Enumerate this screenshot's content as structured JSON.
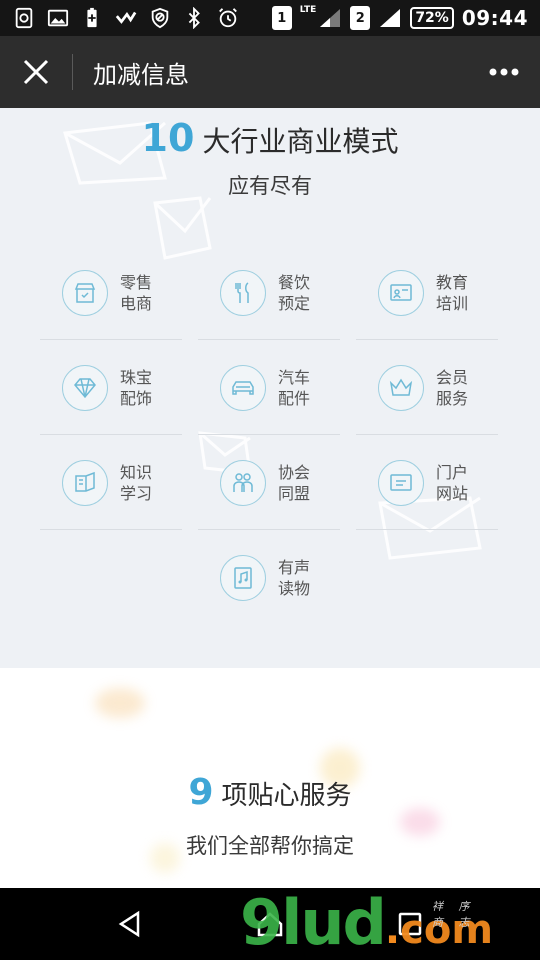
{
  "status_bar": {
    "sim1": "1",
    "network": "LTE",
    "sim2": "2",
    "battery": "72%",
    "time": "09:44",
    "icons": [
      "screenshot-icon",
      "image-icon",
      "battery-saver-icon",
      "check-mark-icon",
      "blocked-icon",
      "bluetooth-icon",
      "alarm-icon"
    ]
  },
  "title_bar": {
    "title": "加减信息",
    "close_icon": "close-icon",
    "more_icon": "more-icon"
  },
  "section1": {
    "number": "10",
    "heading": "大行业商业模式",
    "subheading": "应有尽有",
    "items": [
      {
        "line1": "零售",
        "line2": "电商",
        "icon": "retail-icon"
      },
      {
        "line1": "餐饮",
        "line2": "预定",
        "icon": "dining-icon"
      },
      {
        "line1": "教育",
        "line2": "培训",
        "icon": "education-icon"
      },
      {
        "line1": "珠宝",
        "line2": "配饰",
        "icon": "jewelry-icon"
      },
      {
        "line1": "汽车",
        "line2": "配件",
        "icon": "car-icon"
      },
      {
        "line1": "会员",
        "line2": "服务",
        "icon": "crown-icon"
      },
      {
        "line1": "知识",
        "line2": "学习",
        "icon": "book-icon"
      },
      {
        "line1": "协会",
        "line2": "同盟",
        "icon": "group-icon"
      },
      {
        "line1": "门户",
        "line2": "网站",
        "icon": "portal-icon"
      },
      {
        "line1": "有声",
        "line2": "读物",
        "icon": "audiobook-icon"
      }
    ],
    "accent_color": "#3fa6d6"
  },
  "section2": {
    "number": "9",
    "heading": "项贴心服务",
    "subheading": "我们全部帮你搞定"
  },
  "nav_bar": {
    "back_icon": "back-icon",
    "home_icon": "home-icon",
    "recents_icon": "recents-icon"
  },
  "watermark": {
    "main": "9lud",
    "dot": ".",
    "tld": "com",
    "small": "祥 序 商 志"
  }
}
